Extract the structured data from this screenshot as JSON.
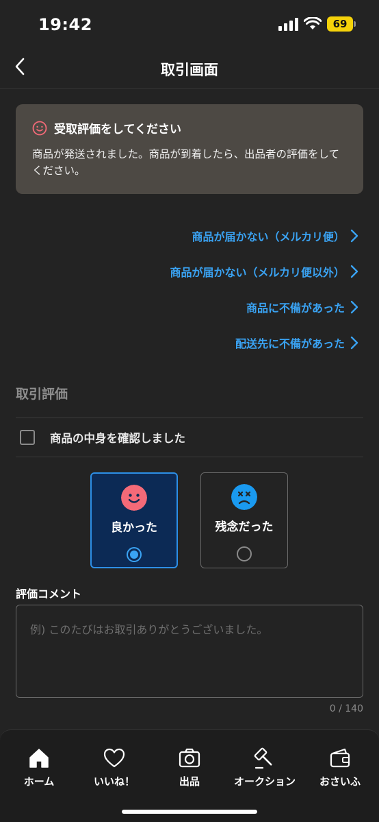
{
  "status_bar": {
    "time": "19:42",
    "battery": "69"
  },
  "header": {
    "title": "取引画面"
  },
  "notice": {
    "title": "受取評価をしてください",
    "body": "商品が発送されました。商品が到着したら、出品者の評価をしてください。"
  },
  "help_links": [
    {
      "label": "商品が届かない（メルカリ便）"
    },
    {
      "label": "商品が届かない（メルカリ便以外）"
    },
    {
      "label": "商品に不備があった"
    },
    {
      "label": "配送先に不備があった"
    }
  ],
  "rating": {
    "section_title": "取引評価",
    "confirm_label": "商品の中身を確認しました",
    "good_label": "良かった",
    "bad_label": "残念だった",
    "selected": "good"
  },
  "comment": {
    "label": "評価コメント",
    "placeholder": "例) このたびはお取引ありがとうございました。",
    "counter": "0 / 140"
  },
  "tabs": [
    {
      "label": "ホーム",
      "icon": "home-icon"
    },
    {
      "label": "いいね！",
      "icon": "heart-icon"
    },
    {
      "label": "出品",
      "icon": "camera-icon"
    },
    {
      "label": "オークション",
      "icon": "gavel-icon"
    },
    {
      "label": "おさいふ",
      "icon": "wallet-icon"
    }
  ],
  "colors": {
    "background": "#232323",
    "accent": "#3aa3f3",
    "notice_bg": "#4d4944",
    "good_face": "#f46a78",
    "bad_face": "#1a9af0"
  }
}
